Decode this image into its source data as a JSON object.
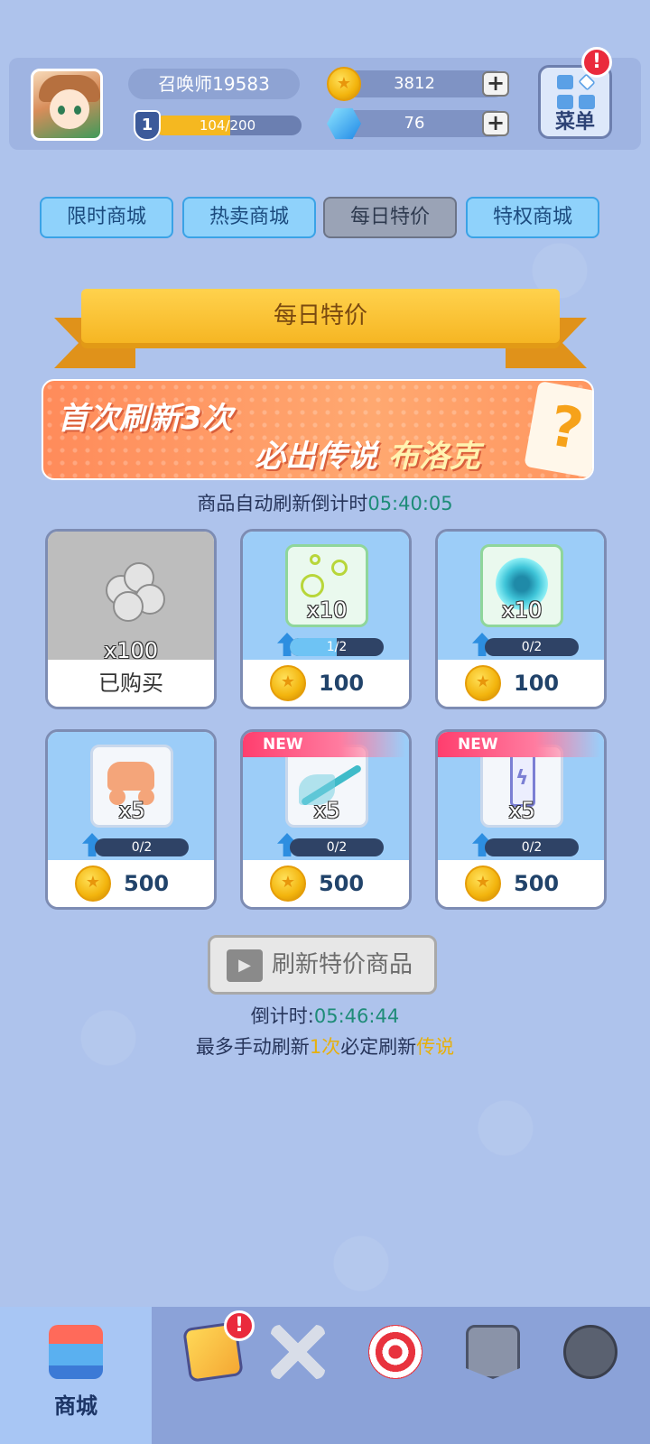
{
  "header": {
    "player_name": "召唤师19583",
    "level": "1",
    "xp_text": "104/200",
    "xp_fraction": 0.52,
    "coins": "3812",
    "gems": "76",
    "menu_label": "菜单",
    "menu_alert": "!"
  },
  "tabs": [
    {
      "label": "限时商城",
      "active": false
    },
    {
      "label": "热卖商城",
      "active": false
    },
    {
      "label": "每日特价",
      "active": true
    },
    {
      "label": "特权商城",
      "active": false
    }
  ],
  "section": {
    "ribbon_title": "每日特价"
  },
  "banner": {
    "line1": "首次刷新3次",
    "line2_prefix": "必出传说",
    "line2_hero": "布洛克",
    "card_symbol": "?"
  },
  "auto_refresh": {
    "label": "商品自动刷新倒计时",
    "time": "05:40:05"
  },
  "products": [
    {
      "name": "silver-coins",
      "count": "x100",
      "status": "已购买",
      "sold": true
    },
    {
      "name": "bubbles",
      "count": "x10",
      "progress_text": "1/2",
      "progress": 0.5,
      "price": "100",
      "new": false
    },
    {
      "name": "vortex",
      "count": "x10",
      "progress_text": "0/2",
      "progress": 0,
      "price": "100",
      "new": false
    },
    {
      "name": "cannon-cart",
      "count": "x5",
      "progress_text": "0/2",
      "progress": 0,
      "price": "500",
      "new": false
    },
    {
      "name": "ice-spear",
      "count": "x5",
      "progress_text": "0/2",
      "progress": 0,
      "price": "500",
      "new": true
    },
    {
      "name": "battery",
      "count": "x5",
      "progress_text": "0/2",
      "progress": 0,
      "price": "500",
      "new": true
    }
  ],
  "new_tag": "NEW",
  "refresh": {
    "button_label": "刷新特价商品",
    "countdown_label": "倒计时:",
    "countdown_time": "05:46:44",
    "note_prefix": "最多手动刷新",
    "note_count": "1次",
    "note_middle": "必定刷新",
    "note_suffix": "传说"
  },
  "nav": {
    "shop_label": "商城",
    "cards_alert": "!"
  },
  "colors": {
    "background": "#aec3ec",
    "tab_active": "#9aa3b6",
    "tab_inactive": "#8fd2fb",
    "ribbon": "#f6b623",
    "teal_text": "#1e8c78",
    "gold_text": "#e7b00c"
  }
}
